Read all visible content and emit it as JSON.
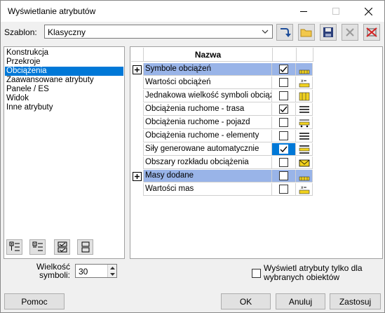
{
  "window": {
    "title": "Wyświetlanie atrybutów"
  },
  "template": {
    "label": "Szablon:",
    "value": "Klasyczny"
  },
  "toolbar_icons": [
    "apply-arrow-icon",
    "open-folder-icon",
    "save-disk-icon",
    "delete-icon",
    "remove-template-icon"
  ],
  "categories": [
    {
      "label": "Konstrukcja",
      "selected": false
    },
    {
      "label": "Przekroje",
      "selected": false
    },
    {
      "label": "Obciążenia",
      "selected": true
    },
    {
      "label": "Zaawansowane atrybuty",
      "selected": false
    },
    {
      "label": "Panele / ES",
      "selected": false
    },
    {
      "label": "Widok",
      "selected": false
    },
    {
      "label": "Inne atrybuty",
      "selected": false
    }
  ],
  "grid": {
    "header": "Nazwa",
    "rows": [
      {
        "name": "Symbole obciążeń",
        "checked": true,
        "group": true
      },
      {
        "name": "Wartości obciążeń",
        "checked": false,
        "group": false
      },
      {
        "name": "Jednakowa wielkość symboli obciążeń",
        "checked": false,
        "group": false
      },
      {
        "name": "Obciążenia ruchome - trasa",
        "checked": true,
        "group": false
      },
      {
        "name": "Obciążenia ruchome - pojazd",
        "checked": false,
        "group": false
      },
      {
        "name": "Obciążenia ruchome - elementy",
        "checked": false,
        "group": false
      },
      {
        "name": "Siły generowane automatycznie",
        "checked": true,
        "group": false,
        "highlighted": true
      },
      {
        "name": "Obszary rozkładu obciążenia",
        "checked": false,
        "group": false
      },
      {
        "name": "Masy dodane",
        "checked": false,
        "group": true
      },
      {
        "name": "Wartości mas",
        "checked": false,
        "group": false
      }
    ]
  },
  "symbol_size": {
    "label_line1": "Wielkość",
    "label_line2": "symboli:",
    "value": "30"
  },
  "selected_only": {
    "label_line1": "Wyświetl atrybuty tylko dla",
    "label_line2": "wybranych obiektów",
    "checked": false
  },
  "buttons": {
    "help": "Pomoc",
    "ok": "OK",
    "cancel": "Anuluj",
    "apply": "Zastosuj"
  }
}
